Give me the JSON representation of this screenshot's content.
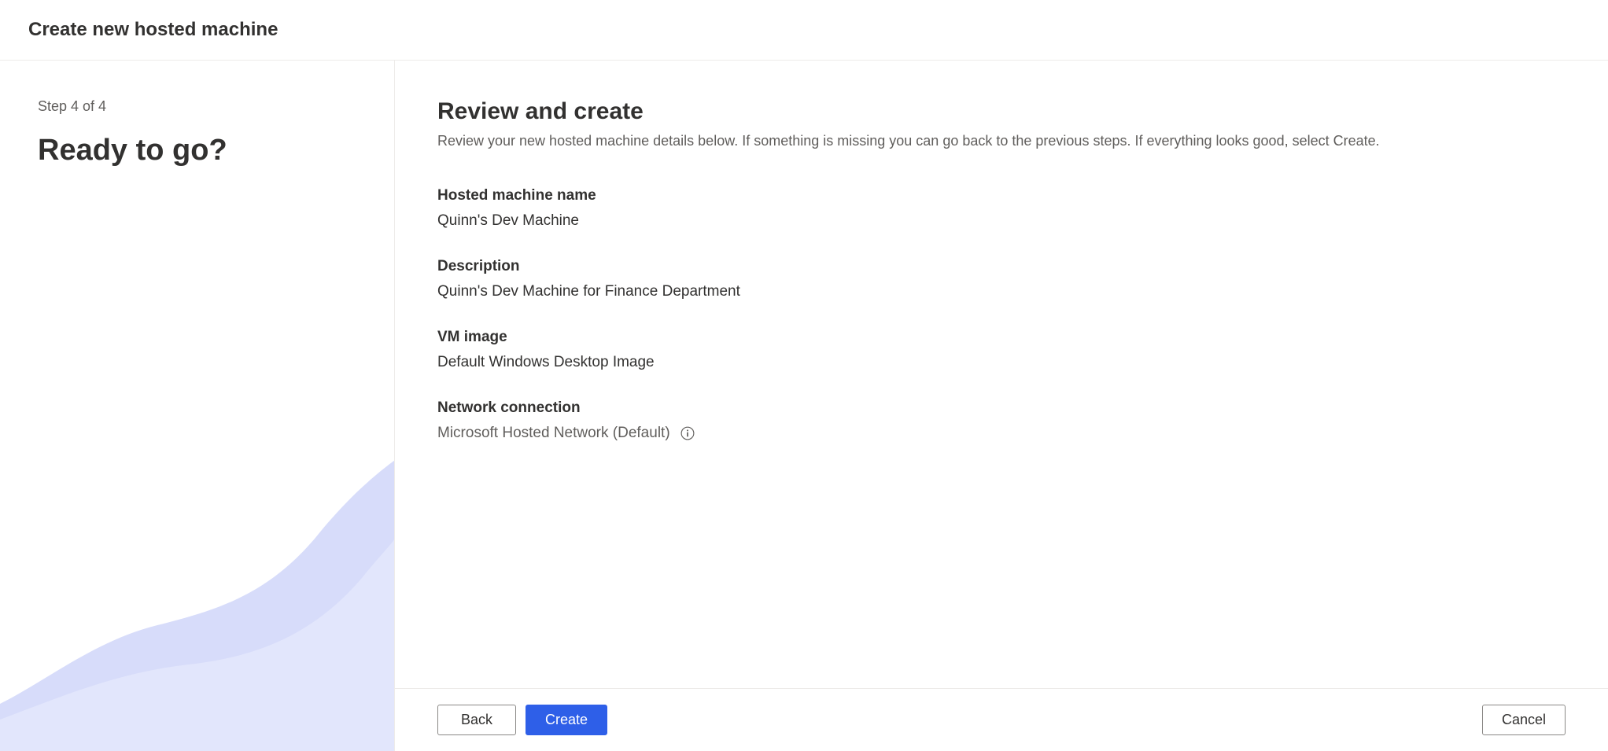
{
  "header": {
    "title": "Create new hosted machine"
  },
  "sidebar": {
    "step_label": "Step 4 of 4",
    "heading": "Ready to go?"
  },
  "main": {
    "title": "Review and create",
    "subtitle": "Review your new hosted machine details below. If something is missing you can go back to the previous steps. If everything looks good, select Create.",
    "fields": {
      "name": {
        "label": "Hosted machine name",
        "value": "Quinn's Dev Machine"
      },
      "description": {
        "label": "Description",
        "value": "Quinn's Dev Machine for Finance Department"
      },
      "vm_image": {
        "label": "VM image",
        "value": "Default Windows Desktop Image"
      },
      "network": {
        "label": "Network connection",
        "value": "Microsoft Hosted Network (Default)"
      }
    }
  },
  "footer": {
    "back": "Back",
    "create": "Create",
    "cancel": "Cancel"
  }
}
